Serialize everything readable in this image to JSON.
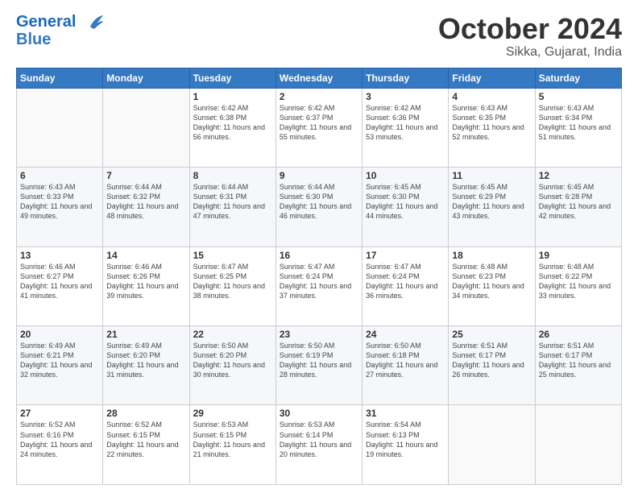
{
  "header": {
    "logo_line1": "General",
    "logo_line2": "Blue",
    "month": "October 2024",
    "location": "Sikka, Gujarat, India"
  },
  "weekdays": [
    "Sunday",
    "Monday",
    "Tuesday",
    "Wednesday",
    "Thursday",
    "Friday",
    "Saturday"
  ],
  "weeks": [
    [
      {
        "day": "",
        "info": ""
      },
      {
        "day": "",
        "info": ""
      },
      {
        "day": "1",
        "info": "Sunrise: 6:42 AM\nSunset: 6:38 PM\nDaylight: 11 hours and 56 minutes."
      },
      {
        "day": "2",
        "info": "Sunrise: 6:42 AM\nSunset: 6:37 PM\nDaylight: 11 hours and 55 minutes."
      },
      {
        "day": "3",
        "info": "Sunrise: 6:42 AM\nSunset: 6:36 PM\nDaylight: 11 hours and 53 minutes."
      },
      {
        "day": "4",
        "info": "Sunrise: 6:43 AM\nSunset: 6:35 PM\nDaylight: 11 hours and 52 minutes."
      },
      {
        "day": "5",
        "info": "Sunrise: 6:43 AM\nSunset: 6:34 PM\nDaylight: 11 hours and 51 minutes."
      }
    ],
    [
      {
        "day": "6",
        "info": "Sunrise: 6:43 AM\nSunset: 6:33 PM\nDaylight: 11 hours and 49 minutes."
      },
      {
        "day": "7",
        "info": "Sunrise: 6:44 AM\nSunset: 6:32 PM\nDaylight: 11 hours and 48 minutes."
      },
      {
        "day": "8",
        "info": "Sunrise: 6:44 AM\nSunset: 6:31 PM\nDaylight: 11 hours and 47 minutes."
      },
      {
        "day": "9",
        "info": "Sunrise: 6:44 AM\nSunset: 6:30 PM\nDaylight: 11 hours and 46 minutes."
      },
      {
        "day": "10",
        "info": "Sunrise: 6:45 AM\nSunset: 6:30 PM\nDaylight: 11 hours and 44 minutes."
      },
      {
        "day": "11",
        "info": "Sunrise: 6:45 AM\nSunset: 6:29 PM\nDaylight: 11 hours and 43 minutes."
      },
      {
        "day": "12",
        "info": "Sunrise: 6:45 AM\nSunset: 6:28 PM\nDaylight: 11 hours and 42 minutes."
      }
    ],
    [
      {
        "day": "13",
        "info": "Sunrise: 6:46 AM\nSunset: 6:27 PM\nDaylight: 11 hours and 41 minutes."
      },
      {
        "day": "14",
        "info": "Sunrise: 6:46 AM\nSunset: 6:26 PM\nDaylight: 11 hours and 39 minutes."
      },
      {
        "day": "15",
        "info": "Sunrise: 6:47 AM\nSunset: 6:25 PM\nDaylight: 11 hours and 38 minutes."
      },
      {
        "day": "16",
        "info": "Sunrise: 6:47 AM\nSunset: 6:24 PM\nDaylight: 11 hours and 37 minutes."
      },
      {
        "day": "17",
        "info": "Sunrise: 6:47 AM\nSunset: 6:24 PM\nDaylight: 11 hours and 36 minutes."
      },
      {
        "day": "18",
        "info": "Sunrise: 6:48 AM\nSunset: 6:23 PM\nDaylight: 11 hours and 34 minutes."
      },
      {
        "day": "19",
        "info": "Sunrise: 6:48 AM\nSunset: 6:22 PM\nDaylight: 11 hours and 33 minutes."
      }
    ],
    [
      {
        "day": "20",
        "info": "Sunrise: 6:49 AM\nSunset: 6:21 PM\nDaylight: 11 hours and 32 minutes."
      },
      {
        "day": "21",
        "info": "Sunrise: 6:49 AM\nSunset: 6:20 PM\nDaylight: 11 hours and 31 minutes."
      },
      {
        "day": "22",
        "info": "Sunrise: 6:50 AM\nSunset: 6:20 PM\nDaylight: 11 hours and 30 minutes."
      },
      {
        "day": "23",
        "info": "Sunrise: 6:50 AM\nSunset: 6:19 PM\nDaylight: 11 hours and 28 minutes."
      },
      {
        "day": "24",
        "info": "Sunrise: 6:50 AM\nSunset: 6:18 PM\nDaylight: 11 hours and 27 minutes."
      },
      {
        "day": "25",
        "info": "Sunrise: 6:51 AM\nSunset: 6:17 PM\nDaylight: 11 hours and 26 minutes."
      },
      {
        "day": "26",
        "info": "Sunrise: 6:51 AM\nSunset: 6:17 PM\nDaylight: 11 hours and 25 minutes."
      }
    ],
    [
      {
        "day": "27",
        "info": "Sunrise: 6:52 AM\nSunset: 6:16 PM\nDaylight: 11 hours and 24 minutes."
      },
      {
        "day": "28",
        "info": "Sunrise: 6:52 AM\nSunset: 6:15 PM\nDaylight: 11 hours and 22 minutes."
      },
      {
        "day": "29",
        "info": "Sunrise: 6:53 AM\nSunset: 6:15 PM\nDaylight: 11 hours and 21 minutes."
      },
      {
        "day": "30",
        "info": "Sunrise: 6:53 AM\nSunset: 6:14 PM\nDaylight: 11 hours and 20 minutes."
      },
      {
        "day": "31",
        "info": "Sunrise: 6:54 AM\nSunset: 6:13 PM\nDaylight: 11 hours and 19 minutes."
      },
      {
        "day": "",
        "info": ""
      },
      {
        "day": "",
        "info": ""
      }
    ]
  ]
}
